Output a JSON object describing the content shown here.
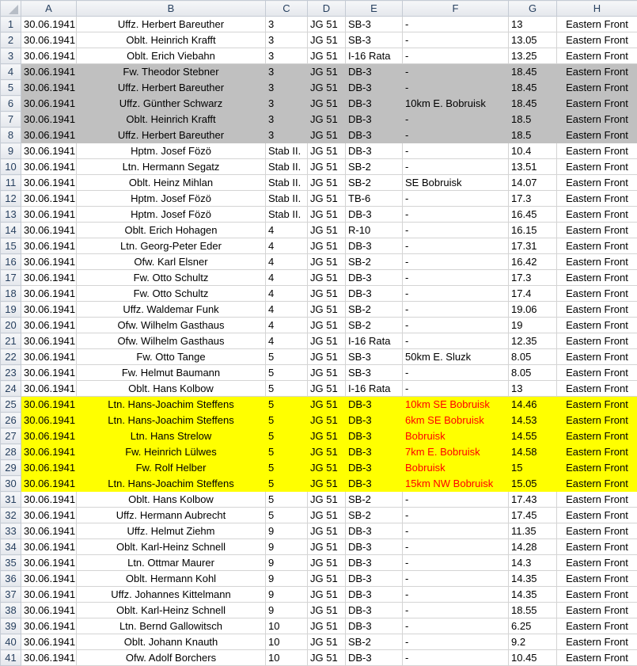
{
  "sheet": {
    "columns": [
      "A",
      "B",
      "C",
      "D",
      "E",
      "F",
      "G",
      "H"
    ],
    "colors": {
      "gray_highlight": "#c0c0c0",
      "yellow_highlight": "#ffff00",
      "red_text": "#ff0000"
    },
    "gray_rows": [
      4,
      5,
      6,
      7,
      8
    ],
    "yellow_rows": [
      25,
      26,
      27,
      28,
      29,
      30
    ],
    "rows": [
      [
        "30.06.1941",
        "Uffz. Herbert Bareuther",
        "3",
        "JG 51",
        "SB-3",
        "-",
        "13",
        "Eastern Front"
      ],
      [
        "30.06.1941",
        "Oblt. Heinrich Krafft",
        "3",
        "JG 51",
        "SB-3",
        "-",
        "13.05",
        "Eastern Front"
      ],
      [
        "30.06.1941",
        "Oblt. Erich Viebahn",
        "3",
        "JG 51",
        "I-16 Rata",
        "-",
        "13.25",
        "Eastern Front"
      ],
      [
        "30.06.1941",
        "Fw. Theodor Stebner",
        "3",
        "JG 51",
        "DB-3",
        "-",
        "18.45",
        "Eastern Front"
      ],
      [
        "30.06.1941",
        "Uffz. Herbert Bareuther",
        "3",
        "JG 51",
        "DB-3",
        "-",
        "18.45",
        "Eastern Front"
      ],
      [
        "30.06.1941",
        "Uffz. Günther Schwarz",
        "3",
        "JG 51",
        "DB-3",
        "10km E. Bobruisk",
        "18.45",
        "Eastern Front"
      ],
      [
        "30.06.1941",
        "Oblt. Heinrich Krafft",
        "3",
        "JG 51",
        "DB-3",
        "-",
        "18.5",
        "Eastern Front"
      ],
      [
        "30.06.1941",
        "Uffz. Herbert Bareuther",
        "3",
        "JG 51",
        "DB-3",
        "-",
        "18.5",
        "Eastern Front"
      ],
      [
        "30.06.1941",
        "Hptm. Josef Fözö",
        "Stab II.",
        "JG 51",
        "DB-3",
        "-",
        "10.4",
        "Eastern Front"
      ],
      [
        "30.06.1941",
        "Ltn. Hermann Segatz",
        "Stab II.",
        "JG 51",
        "SB-2",
        "-",
        "13.51",
        "Eastern Front"
      ],
      [
        "30.06.1941",
        "Oblt. Heinz Mihlan",
        "Stab II.",
        "JG 51",
        "SB-2",
        "SE Bobruisk",
        "14.07",
        "Eastern Front"
      ],
      [
        "30.06.1941",
        "Hptm. Josef Fözö",
        "Stab II.",
        "JG 51",
        "TB-6",
        "-",
        "17.3",
        "Eastern Front"
      ],
      [
        "30.06.1941",
        "Hptm. Josef Fözö",
        "Stab II.",
        "JG 51",
        "DB-3",
        "-",
        "16.45",
        "Eastern Front"
      ],
      [
        "30.06.1941",
        "Oblt. Erich Hohagen",
        "4",
        "JG 51",
        "R-10",
        "-",
        "16.15",
        "Eastern Front"
      ],
      [
        "30.06.1941",
        "Ltn. Georg-Peter Eder",
        "4",
        "JG 51",
        "DB-3",
        "-",
        "17.31",
        "Eastern Front"
      ],
      [
        "30.06.1941",
        "Ofw. Karl Elsner",
        "4",
        "JG 51",
        "SB-2",
        "-",
        "16.42",
        "Eastern Front"
      ],
      [
        "30.06.1941",
        "Fw. Otto Schultz",
        "4",
        "JG 51",
        "DB-3",
        "-",
        "17.3",
        "Eastern Front"
      ],
      [
        "30.06.1941",
        "Fw. Otto Schultz",
        "4",
        "JG 51",
        "DB-3",
        "-",
        "17.4",
        "Eastern Front"
      ],
      [
        "30.06.1941",
        "Uffz. Waldemar Funk",
        "4",
        "JG 51",
        "SB-2",
        "-",
        "19.06",
        "Eastern Front"
      ],
      [
        "30.06.1941",
        "Ofw. Wilhelm Gasthaus",
        "4",
        "JG 51",
        "SB-2",
        "-",
        "19",
        "Eastern Front"
      ],
      [
        "30.06.1941",
        "Ofw. Wilhelm Gasthaus",
        "4",
        "JG 51",
        "I-16 Rata",
        "-",
        "12.35",
        "Eastern Front"
      ],
      [
        "30.06.1941",
        "Fw. Otto Tange",
        "5",
        "JG 51",
        "SB-3",
        "50km E. Sluzk",
        "8.05",
        "Eastern Front"
      ],
      [
        "30.06.1941",
        "Fw. Helmut Baumann",
        "5",
        "JG 51",
        "SB-3",
        "-",
        "8.05",
        "Eastern Front"
      ],
      [
        "30.06.1941",
        "Oblt. Hans Kolbow",
        "5",
        "JG 51",
        "I-16 Rata",
        "-",
        "13",
        "Eastern Front"
      ],
      [
        "30.06.1941",
        "Ltn. Hans-Joachim Steffens",
        "5",
        "JG 51",
        "DB-3",
        "10km SE Bobruisk",
        "14.46",
        "Eastern Front"
      ],
      [
        "30.06.1941",
        "Ltn. Hans-Joachim Steffens",
        "5",
        "JG 51",
        "DB-3",
        "6km SE Bobruisk",
        "14.53",
        "Eastern Front"
      ],
      [
        "30.06.1941",
        "Ltn. Hans Strelow",
        "5",
        "JG 51",
        "DB-3",
        "Bobruisk",
        "14.55",
        "Eastern Front"
      ],
      [
        "30.06.1941",
        "Fw. Heinrich Lülwes",
        "5",
        "JG 51",
        "DB-3",
        "7km E. Bobruisk",
        "14.58",
        "Eastern Front"
      ],
      [
        "30.06.1941",
        "Fw. Rolf Helber",
        "5",
        "JG 51",
        "DB-3",
        "Bobruisk",
        "15",
        "Eastern Front"
      ],
      [
        "30.06.1941",
        "Ltn. Hans-Joachim Steffens",
        "5",
        "JG 51",
        "DB-3",
        "15km NW Bobruisk",
        "15.05",
        "Eastern Front"
      ],
      [
        "30.06.1941",
        "Oblt. Hans Kolbow",
        "5",
        "JG 51",
        "SB-2",
        "-",
        "17.43",
        "Eastern Front"
      ],
      [
        "30.06.1941",
        "Uffz. Hermann Aubrecht",
        "5",
        "JG 51",
        "SB-2",
        "-",
        "17.45",
        "Eastern Front"
      ],
      [
        "30.06.1941",
        "Uffz. Helmut Ziehm",
        "9",
        "JG 51",
        "DB-3",
        "-",
        "11.35",
        "Eastern Front"
      ],
      [
        "30.06.1941",
        "Oblt. Karl-Heinz Schnell",
        "9",
        "JG 51",
        "DB-3",
        "-",
        "14.28",
        "Eastern Front"
      ],
      [
        "30.06.1941",
        "Ltn. Ottmar Maurer",
        "9",
        "JG 51",
        "DB-3",
        "-",
        "14.3",
        "Eastern Front"
      ],
      [
        "30.06.1941",
        "Oblt. Hermann Kohl",
        "9",
        "JG 51",
        "DB-3",
        "-",
        "14.35",
        "Eastern Front"
      ],
      [
        "30.06.1941",
        "Uffz. Johannes Kittelmann",
        "9",
        "JG 51",
        "DB-3",
        "-",
        "14.35",
        "Eastern Front"
      ],
      [
        "30.06.1941",
        "Oblt. Karl-Heinz Schnell",
        "9",
        "JG 51",
        "DB-3",
        "-",
        "18.55",
        "Eastern Front"
      ],
      [
        "30.06.1941",
        "Ltn. Bernd Gallowitsch",
        "10",
        "JG 51",
        "DB-3",
        "-",
        "6.25",
        "Eastern Front"
      ],
      [
        "30.06.1941",
        "Oblt. Johann Knauth",
        "10",
        "JG 51",
        "SB-2",
        "-",
        "9.2",
        "Eastern Front"
      ],
      [
        "30.06.1941",
        "Ofw. Adolf Borchers",
        "10",
        "JG 51",
        "DB-3",
        "-",
        "10.45",
        "Eastern Front"
      ]
    ]
  }
}
